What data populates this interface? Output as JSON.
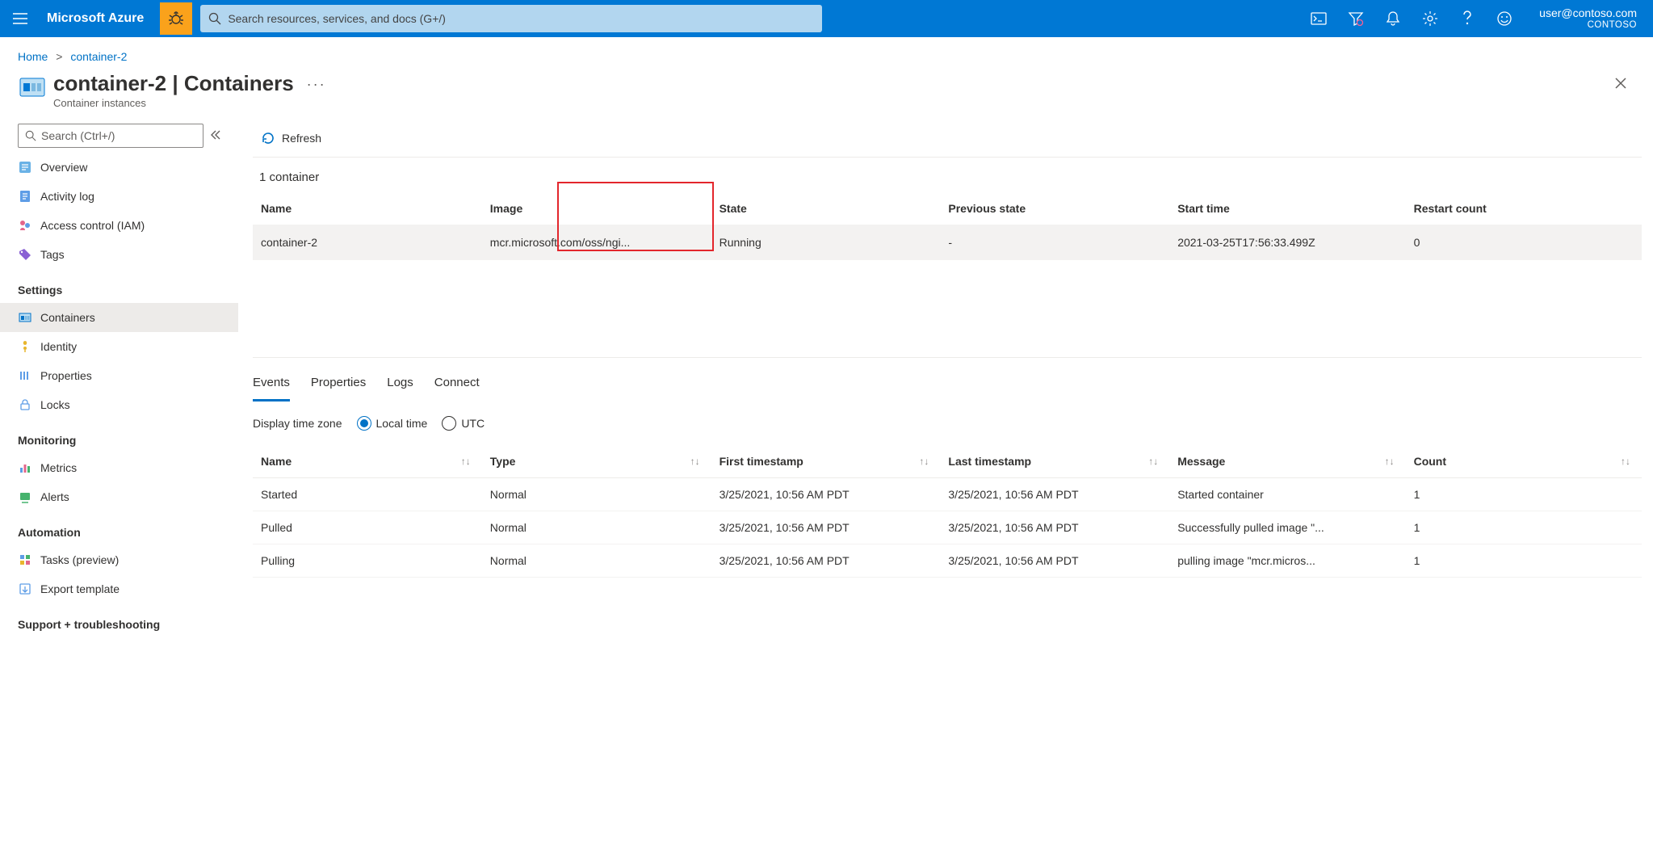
{
  "topbar": {
    "brand": "Microsoft Azure",
    "search_placeholder": "Search resources, services, and docs (G+/)",
    "user_email": "user@contoso.com",
    "tenant": "CONTOSO"
  },
  "breadcrumb": {
    "home": "Home",
    "current": "container-2"
  },
  "header": {
    "title": "container-2 | Containers",
    "subtitle": "Container instances"
  },
  "sidebar": {
    "search_placeholder": "Search (Ctrl+/)",
    "top": [
      {
        "label": "Overview"
      },
      {
        "label": "Activity log"
      },
      {
        "label": "Access control (IAM)"
      },
      {
        "label": "Tags"
      }
    ],
    "settings_title": "Settings",
    "settings": [
      {
        "label": "Containers",
        "active": true
      },
      {
        "label": "Identity"
      },
      {
        "label": "Properties"
      },
      {
        "label": "Locks"
      }
    ],
    "monitoring_title": "Monitoring",
    "monitoring": [
      {
        "label": "Metrics"
      },
      {
        "label": "Alerts"
      }
    ],
    "automation_title": "Automation",
    "automation": [
      {
        "label": "Tasks (preview)"
      },
      {
        "label": "Export template"
      }
    ],
    "support_title": "Support + troubleshooting"
  },
  "toolbar": {
    "refresh": "Refresh"
  },
  "container_summary": "1 container",
  "containers_table": {
    "headers": {
      "name": "Name",
      "image": "Image",
      "state": "State",
      "prev": "Previous state",
      "start": "Start time",
      "restart": "Restart count"
    },
    "rows": [
      {
        "name": "container-2",
        "image": "mcr.microsoft.com/oss/ngi...",
        "state": "Running",
        "prev": "-",
        "start": "2021-03-25T17:56:33.499Z",
        "restart": "0"
      }
    ]
  },
  "bottom": {
    "tabs": {
      "events": "Events",
      "properties": "Properties",
      "logs": "Logs",
      "connect": "Connect"
    },
    "tz_label": "Display time zone",
    "tz_local": "Local time",
    "tz_utc": "UTC",
    "events_table": {
      "headers": {
        "name": "Name",
        "type": "Type",
        "first": "First timestamp",
        "last": "Last timestamp",
        "msg": "Message",
        "count": "Count"
      },
      "rows": [
        {
          "name": "Started",
          "type": "Normal",
          "first": "3/25/2021, 10:56 AM PDT",
          "last": "3/25/2021, 10:56 AM PDT",
          "msg": "Started container",
          "count": "1"
        },
        {
          "name": "Pulled",
          "type": "Normal",
          "first": "3/25/2021, 10:56 AM PDT",
          "last": "3/25/2021, 10:56 AM PDT",
          "msg": "Successfully pulled image \"...",
          "count": "1"
        },
        {
          "name": "Pulling",
          "type": "Normal",
          "first": "3/25/2021, 10:56 AM PDT",
          "last": "3/25/2021, 10:56 AM PDT",
          "msg": "pulling image \"mcr.micros...",
          "count": "1"
        }
      ]
    }
  }
}
